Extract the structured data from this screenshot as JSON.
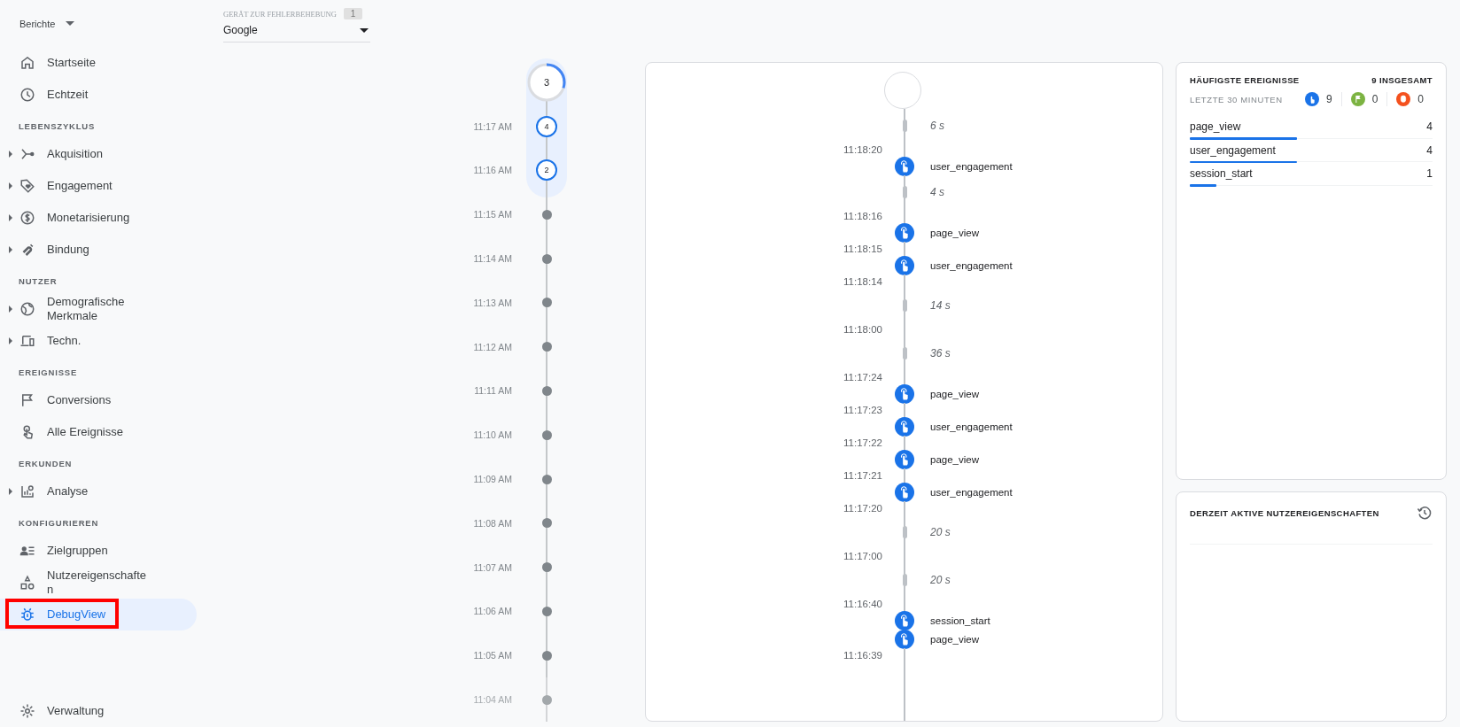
{
  "nav": {
    "title": "Berichte",
    "sections": [
      {
        "items": [
          {
            "label": "Startseite",
            "expandable": false,
            "selected": false,
            "annotated": false
          },
          {
            "label": "Echtzeit",
            "expandable": false,
            "selected": false,
            "annotated": false
          }
        ]
      },
      {
        "heading": "LEBENSZYKLUS",
        "items": [
          {
            "label": "Akquisition",
            "expandable": true,
            "selected": false,
            "annotated": false
          },
          {
            "label": "Engagement",
            "expandable": true,
            "selected": false,
            "annotated": false
          },
          {
            "label": "Monetarisierung",
            "expandable": true,
            "selected": false,
            "annotated": false
          },
          {
            "label": "Bindung",
            "expandable": true,
            "selected": false,
            "annotated": false
          }
        ]
      },
      {
        "heading": "NUTZER",
        "items": [
          {
            "label": "Demografische Merkmale",
            "expandable": true,
            "selected": false,
            "annotated": false
          },
          {
            "label": "Techn.",
            "expandable": true,
            "selected": false,
            "annotated": false
          }
        ]
      },
      {
        "heading": "EREIGNISSE",
        "items": [
          {
            "label": "Conversions",
            "expandable": false,
            "selected": false,
            "annotated": false
          },
          {
            "label": "Alle Ereignisse",
            "expandable": false,
            "selected": false,
            "annotated": false
          }
        ]
      },
      {
        "heading": "ERKUNDEN",
        "items": [
          {
            "label": "Analyse",
            "expandable": true,
            "selected": false,
            "annotated": false
          }
        ]
      },
      {
        "heading": "KONFIGURIEREN",
        "items": [
          {
            "label": "Zielgruppen",
            "expandable": false,
            "selected": false,
            "annotated": false
          },
          {
            "label": "Nutzereigenschaften",
            "expandable": false,
            "selected": false,
            "annotated": false
          },
          {
            "label": "DebugView",
            "expandable": false,
            "selected": true,
            "annotated": true
          }
        ]
      }
    ],
    "footer": {
      "label": "Verwaltung"
    }
  },
  "device": {
    "label": "GERÄT ZUR FEHLERBEHEBUNG",
    "count": "1",
    "value": "Google"
  },
  "minutes": [
    {
      "count": "3",
      "kind": "current",
      "level": 0.3
    },
    {
      "time": "11:17 AM",
      "count": "4",
      "kind": "active"
    },
    {
      "time": "11:16 AM",
      "count": "2",
      "kind": "active"
    },
    {
      "time": "11:15 AM",
      "kind": "empty"
    },
    {
      "time": "11:14 AM",
      "kind": "empty"
    },
    {
      "time": "11:13 AM",
      "kind": "empty"
    },
    {
      "time": "11:12 AM",
      "kind": "empty"
    },
    {
      "time": "11:11 AM",
      "kind": "empty"
    },
    {
      "time": "11:10 AM",
      "kind": "empty"
    },
    {
      "time": "11:09 AM",
      "kind": "empty"
    },
    {
      "time": "11:08 AM",
      "kind": "empty"
    },
    {
      "time": "11:07 AM",
      "kind": "empty"
    },
    {
      "time": "11:06 AM",
      "kind": "empty"
    },
    {
      "time": "11:05 AM",
      "kind": "empty"
    },
    {
      "time": "11:04 AM",
      "kind": "empty"
    }
  ],
  "stream": [
    {
      "kind": "gap",
      "text": "6 s"
    },
    {
      "kind": "time",
      "text": "11:18:20"
    },
    {
      "kind": "event",
      "text": "user_engagement"
    },
    {
      "kind": "gap",
      "text": "4 s"
    },
    {
      "kind": "time",
      "text": "11:18:16"
    },
    {
      "kind": "event",
      "text": "page_view"
    },
    {
      "kind": "time",
      "text": "11:18:15"
    },
    {
      "kind": "event",
      "text": "user_engagement"
    },
    {
      "kind": "time",
      "text": "11:18:14"
    },
    {
      "kind": "gap",
      "text": "14 s"
    },
    {
      "kind": "time",
      "text": "11:18:00"
    },
    {
      "kind": "gap",
      "text": "36 s"
    },
    {
      "kind": "time",
      "text": "11:17:24"
    },
    {
      "kind": "event",
      "text": "page_view"
    },
    {
      "kind": "time",
      "text": "11:17:23"
    },
    {
      "kind": "event",
      "text": "user_engagement"
    },
    {
      "kind": "time",
      "text": "11:17:22"
    },
    {
      "kind": "event",
      "text": "page_view"
    },
    {
      "kind": "time",
      "text": "11:17:21"
    },
    {
      "kind": "event",
      "text": "user_engagement"
    },
    {
      "kind": "time",
      "text": "11:17:20"
    },
    {
      "kind": "gap",
      "text": "20 s"
    },
    {
      "kind": "time",
      "text": "11:17:00"
    },
    {
      "kind": "gap",
      "text": "20 s"
    },
    {
      "kind": "time",
      "text": "11:16:40"
    },
    {
      "kind": "event",
      "text": "session_start"
    },
    {
      "kind": "event",
      "text": "page_view"
    },
    {
      "kind": "time",
      "text": "11:16:39"
    }
  ],
  "top_events": {
    "title": "HÄUFIGSTE EREIGNISSE",
    "total": "9 INSGESAMT",
    "subtitle": "LETZTE 30 MINUTEN",
    "counters": [
      {
        "count": "9",
        "color": "#1a73e8"
      },
      {
        "count": "0",
        "color": "#7cb342"
      },
      {
        "count": "0",
        "color": "#f4511e"
      }
    ],
    "rows": [
      {
        "name": "page_view",
        "count": "4",
        "level": 0.44
      },
      {
        "name": "user_engagement",
        "count": "4",
        "level": 0.44
      },
      {
        "name": "session_start",
        "count": "1",
        "level": 0.11
      }
    ]
  },
  "user_properties": {
    "title": "DERZEIT AKTIVE NUTZEREIGENSCHAFTEN"
  }
}
